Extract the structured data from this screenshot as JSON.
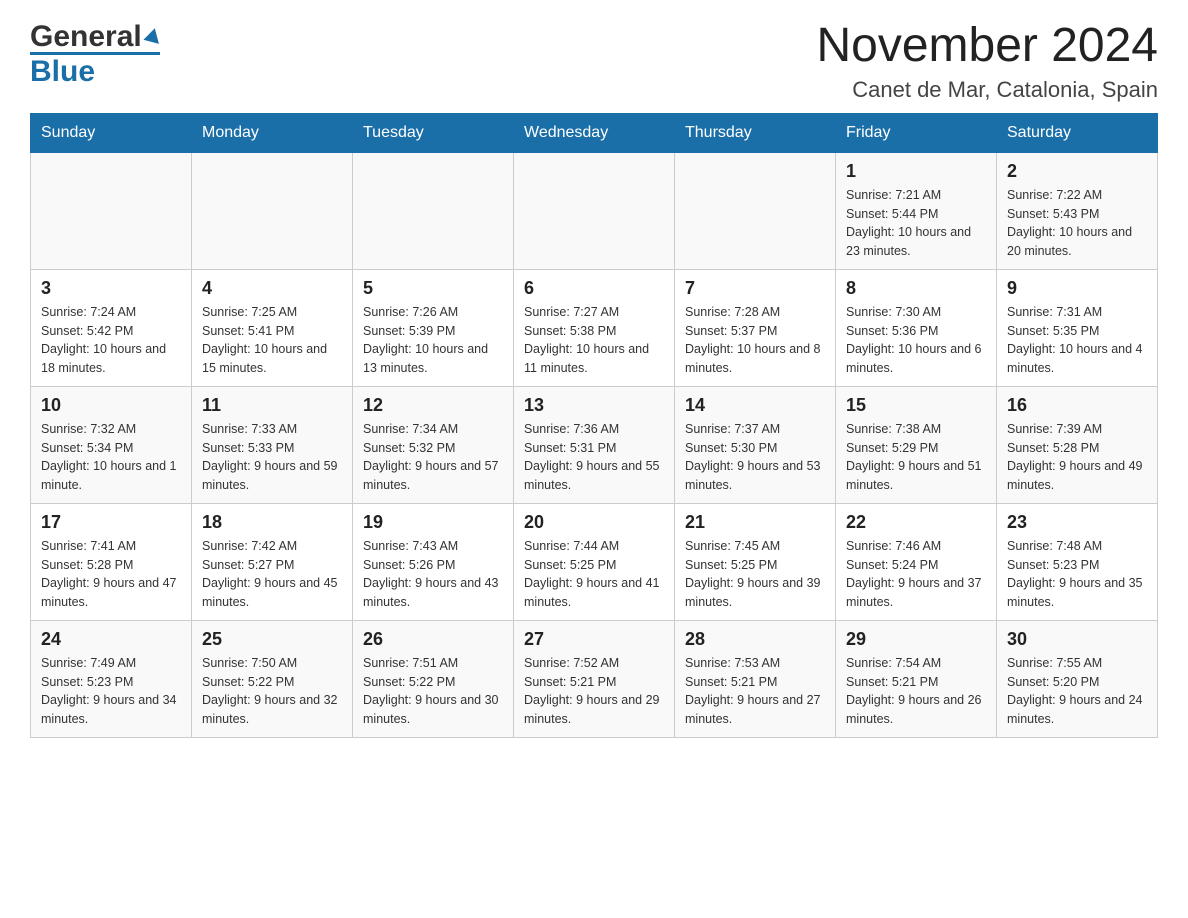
{
  "logo": {
    "general": "General",
    "blue": "Blue"
  },
  "title": "November 2024",
  "subtitle": "Canet de Mar, Catalonia, Spain",
  "days_of_week": [
    "Sunday",
    "Monday",
    "Tuesday",
    "Wednesday",
    "Thursday",
    "Friday",
    "Saturday"
  ],
  "weeks": [
    [
      {
        "day": "",
        "info": ""
      },
      {
        "day": "",
        "info": ""
      },
      {
        "day": "",
        "info": ""
      },
      {
        "day": "",
        "info": ""
      },
      {
        "day": "",
        "info": ""
      },
      {
        "day": "1",
        "info": "Sunrise: 7:21 AM\nSunset: 5:44 PM\nDaylight: 10 hours and 23 minutes."
      },
      {
        "day": "2",
        "info": "Sunrise: 7:22 AM\nSunset: 5:43 PM\nDaylight: 10 hours and 20 minutes."
      }
    ],
    [
      {
        "day": "3",
        "info": "Sunrise: 7:24 AM\nSunset: 5:42 PM\nDaylight: 10 hours and 18 minutes."
      },
      {
        "day": "4",
        "info": "Sunrise: 7:25 AM\nSunset: 5:41 PM\nDaylight: 10 hours and 15 minutes."
      },
      {
        "day": "5",
        "info": "Sunrise: 7:26 AM\nSunset: 5:39 PM\nDaylight: 10 hours and 13 minutes."
      },
      {
        "day": "6",
        "info": "Sunrise: 7:27 AM\nSunset: 5:38 PM\nDaylight: 10 hours and 11 minutes."
      },
      {
        "day": "7",
        "info": "Sunrise: 7:28 AM\nSunset: 5:37 PM\nDaylight: 10 hours and 8 minutes."
      },
      {
        "day": "8",
        "info": "Sunrise: 7:30 AM\nSunset: 5:36 PM\nDaylight: 10 hours and 6 minutes."
      },
      {
        "day": "9",
        "info": "Sunrise: 7:31 AM\nSunset: 5:35 PM\nDaylight: 10 hours and 4 minutes."
      }
    ],
    [
      {
        "day": "10",
        "info": "Sunrise: 7:32 AM\nSunset: 5:34 PM\nDaylight: 10 hours and 1 minute."
      },
      {
        "day": "11",
        "info": "Sunrise: 7:33 AM\nSunset: 5:33 PM\nDaylight: 9 hours and 59 minutes."
      },
      {
        "day": "12",
        "info": "Sunrise: 7:34 AM\nSunset: 5:32 PM\nDaylight: 9 hours and 57 minutes."
      },
      {
        "day": "13",
        "info": "Sunrise: 7:36 AM\nSunset: 5:31 PM\nDaylight: 9 hours and 55 minutes."
      },
      {
        "day": "14",
        "info": "Sunrise: 7:37 AM\nSunset: 5:30 PM\nDaylight: 9 hours and 53 minutes."
      },
      {
        "day": "15",
        "info": "Sunrise: 7:38 AM\nSunset: 5:29 PM\nDaylight: 9 hours and 51 minutes."
      },
      {
        "day": "16",
        "info": "Sunrise: 7:39 AM\nSunset: 5:28 PM\nDaylight: 9 hours and 49 minutes."
      }
    ],
    [
      {
        "day": "17",
        "info": "Sunrise: 7:41 AM\nSunset: 5:28 PM\nDaylight: 9 hours and 47 minutes."
      },
      {
        "day": "18",
        "info": "Sunrise: 7:42 AM\nSunset: 5:27 PM\nDaylight: 9 hours and 45 minutes."
      },
      {
        "day": "19",
        "info": "Sunrise: 7:43 AM\nSunset: 5:26 PM\nDaylight: 9 hours and 43 minutes."
      },
      {
        "day": "20",
        "info": "Sunrise: 7:44 AM\nSunset: 5:25 PM\nDaylight: 9 hours and 41 minutes."
      },
      {
        "day": "21",
        "info": "Sunrise: 7:45 AM\nSunset: 5:25 PM\nDaylight: 9 hours and 39 minutes."
      },
      {
        "day": "22",
        "info": "Sunrise: 7:46 AM\nSunset: 5:24 PM\nDaylight: 9 hours and 37 minutes."
      },
      {
        "day": "23",
        "info": "Sunrise: 7:48 AM\nSunset: 5:23 PM\nDaylight: 9 hours and 35 minutes."
      }
    ],
    [
      {
        "day": "24",
        "info": "Sunrise: 7:49 AM\nSunset: 5:23 PM\nDaylight: 9 hours and 34 minutes."
      },
      {
        "day": "25",
        "info": "Sunrise: 7:50 AM\nSunset: 5:22 PM\nDaylight: 9 hours and 32 minutes."
      },
      {
        "day": "26",
        "info": "Sunrise: 7:51 AM\nSunset: 5:22 PM\nDaylight: 9 hours and 30 minutes."
      },
      {
        "day": "27",
        "info": "Sunrise: 7:52 AM\nSunset: 5:21 PM\nDaylight: 9 hours and 29 minutes."
      },
      {
        "day": "28",
        "info": "Sunrise: 7:53 AM\nSunset: 5:21 PM\nDaylight: 9 hours and 27 minutes."
      },
      {
        "day": "29",
        "info": "Sunrise: 7:54 AM\nSunset: 5:21 PM\nDaylight: 9 hours and 26 minutes."
      },
      {
        "day": "30",
        "info": "Sunrise: 7:55 AM\nSunset: 5:20 PM\nDaylight: 9 hours and 24 minutes."
      }
    ]
  ]
}
